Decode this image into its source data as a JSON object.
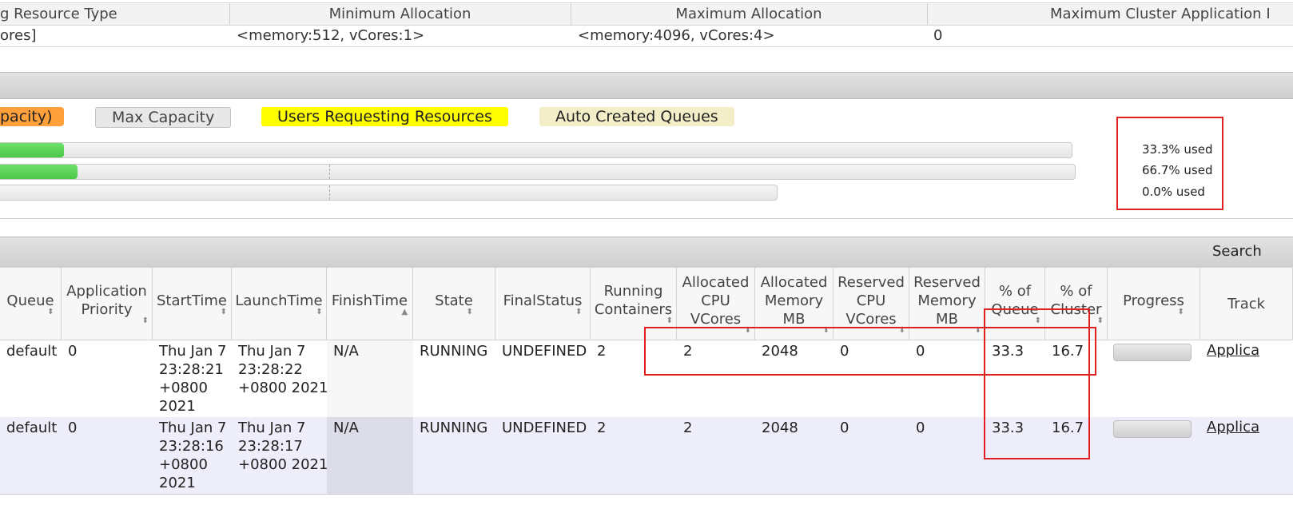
{
  "resource_table": {
    "headers": [
      "g Resource Type",
      "Minimum Allocation",
      "Maximum Allocation",
      "Maximum Cluster Application I"
    ],
    "row": [
      "ores]",
      "<memory:512, vCores:1>",
      "<memory:4096, vCores:4>",
      "0"
    ]
  },
  "legend": {
    "capacity": "pacity)",
    "max_capacity": "Max Capacity",
    "users_requesting": "Users Requesting Resources",
    "auto_created": "Auto Created Queues"
  },
  "colors": {
    "capacity": "#ffa03a",
    "max_capacity": "#e8e8e8",
    "users_requesting": "#ffff00",
    "auto_created": "#f3eec7",
    "used_fill": "#55d451",
    "highlight": "#e02020"
  },
  "queue_usage": [
    {
      "used_text": "33.3% used",
      "fill_fraction": 0.062
    },
    {
      "used_text": "66.7% used",
      "fill_fraction": 0.074
    },
    {
      "used_text": "0.0% used",
      "fill_fraction": 0.0
    }
  ],
  "search_label": "Search",
  "apps_table": {
    "columns": [
      {
        "key": "queue",
        "label": "Queue"
      },
      {
        "key": "priority",
        "label": "Application Priority"
      },
      {
        "key": "start",
        "label": "StartTime"
      },
      {
        "key": "launch",
        "label": "LaunchTime"
      },
      {
        "key": "finish",
        "label": "FinishTime"
      },
      {
        "key": "state",
        "label": "State"
      },
      {
        "key": "final",
        "label": "FinalStatus"
      },
      {
        "key": "containers",
        "label": "Running Containers"
      },
      {
        "key": "cpu",
        "label": "Allocated CPU VCores"
      },
      {
        "key": "mem",
        "label": "Allocated Memory MB"
      },
      {
        "key": "rcpu",
        "label": "Reserved CPU VCores"
      },
      {
        "key": "rmem",
        "label": "Reserved Memory MB"
      },
      {
        "key": "pqueue",
        "label": "% of Queue"
      },
      {
        "key": "pcluster",
        "label": "% of Cluster"
      },
      {
        "key": "progress",
        "label": "Progress"
      },
      {
        "key": "tracking",
        "label": "Track"
      }
    ],
    "rows": [
      {
        "queue": "default",
        "priority": "0",
        "start": "Thu Jan 7\n23:28:21\n+0800\n2021",
        "launch": "Thu Jan 7\n23:28:22\n+0800 2021",
        "finish": "N/A",
        "state": "RUNNING",
        "final": "UNDEFINED",
        "containers": "2",
        "cpu": "2",
        "mem": "2048",
        "rcpu": "0",
        "rmem": "0",
        "pqueue": "33.3",
        "pcluster": "16.7",
        "progress": 0.0,
        "tracking": "Applica"
      },
      {
        "queue": "default",
        "priority": "0",
        "start": "Thu Jan 7\n23:28:16\n+0800\n2021",
        "launch": "Thu Jan 7\n23:28:17\n+0800 2021",
        "finish": "N/A",
        "state": "RUNNING",
        "final": "UNDEFINED",
        "containers": "2",
        "cpu": "2",
        "mem": "2048",
        "rcpu": "0",
        "rmem": "0",
        "pqueue": "33.3",
        "pcluster": "16.7",
        "progress": 0.0,
        "tracking": "Applica"
      }
    ]
  }
}
